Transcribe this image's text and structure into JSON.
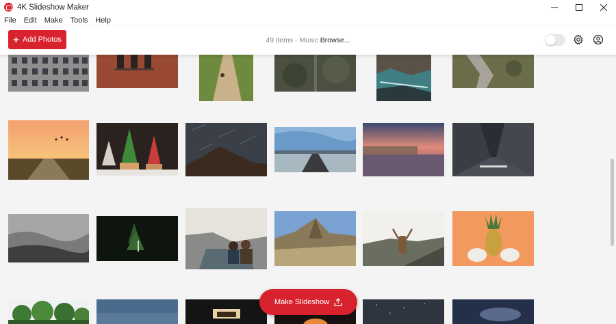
{
  "window": {
    "title": "4K Slideshow Maker",
    "controls": [
      "minimize-icon",
      "maximize-icon",
      "close-icon"
    ]
  },
  "menu": [
    "File",
    "Edit",
    "Make",
    "Tools",
    "Help"
  ],
  "toolbar": {
    "add_photos_label": "Add Photos",
    "items_count": "49 items",
    "separator": "·",
    "music_label": "Music",
    "browse_label": "Browse...",
    "toggle_on": false,
    "icons": [
      "gear-icon",
      "account-icon"
    ]
  },
  "photos": [
    {
      "name": "building-windows"
    },
    {
      "name": "brick-wall-windows"
    },
    {
      "name": "dirt-path-walker"
    },
    {
      "name": "aerial-forest-road"
    },
    {
      "name": "rocky-river"
    },
    {
      "name": "aerial-stream-rocks"
    },
    {
      "name": "sunset-road-birds"
    },
    {
      "name": "christmas-cupcakes"
    },
    {
      "name": "star-trails-rock"
    },
    {
      "name": "coastal-road-horizon"
    },
    {
      "name": "river-city-sunset"
    },
    {
      "name": "city-street-only-left"
    },
    {
      "name": "misty-forest-hills"
    },
    {
      "name": "dark-forest-waterfall"
    },
    {
      "name": "couple-canyon-lake"
    },
    {
      "name": "mountain-valley-aerial"
    },
    {
      "name": "woman-cliff-arms-raised"
    },
    {
      "name": "pineapple-toys-orange"
    },
    {
      "name": "green-trees"
    },
    {
      "name": "blue-sky"
    },
    {
      "name": "lit-window-night"
    },
    {
      "name": "campfire"
    },
    {
      "name": "starry-night-trees"
    },
    {
      "name": "dark-clouds"
    }
  ],
  "make_slideshow_label": "Make Slideshow",
  "colors": {
    "accent": "#d8232f",
    "background": "#f4f4f4"
  }
}
